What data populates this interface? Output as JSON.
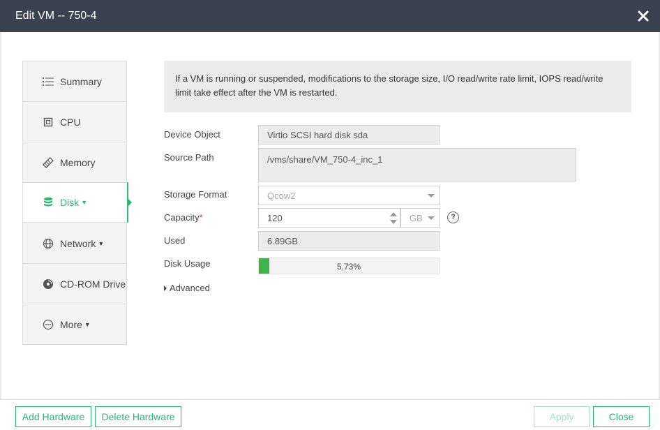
{
  "dialog": {
    "title": "Edit VM -- 750-4"
  },
  "nav": {
    "items": [
      {
        "label": "Summary",
        "icon": "list-icon"
      },
      {
        "label": "CPU",
        "icon": "cpu-icon"
      },
      {
        "label": "Memory",
        "icon": "memory-icon"
      },
      {
        "label": "Disk",
        "icon": "database-icon",
        "active": true,
        "dropdown": true
      },
      {
        "label": "Network",
        "icon": "globe-icon",
        "dropdown": true
      },
      {
        "label": "CD-ROM Drive",
        "icon": "disc-icon"
      },
      {
        "label": "More",
        "icon": "more-icon",
        "dropdown": true
      }
    ]
  },
  "notice": "If a VM is running or suspended, modifications to the storage size, I/O read/write rate limit, IOPS read/write limit take effect after the VM is restarted.",
  "form": {
    "device_object": {
      "label": "Device Object",
      "value": "Virtio SCSI hard disk sda"
    },
    "source_path": {
      "label": "Source Path",
      "value": "/vms/share/VM_750-4_inc_1"
    },
    "storage_format": {
      "label": "Storage Format",
      "value": "Qcow2"
    },
    "capacity": {
      "label": "Capacity",
      "required_mark": "*",
      "value": "120",
      "unit": "GB",
      "help": "?"
    },
    "used": {
      "label": "Used",
      "value": "6.89GB"
    },
    "disk_usage": {
      "label": "Disk Usage",
      "percent_text": "5.73%",
      "percent": 5.73
    },
    "advanced": "Advanced"
  },
  "footer": {
    "add_hardware": "Add Hardware",
    "delete_hardware": "Delete Hardware",
    "apply": "Apply",
    "close": "Close"
  },
  "colors": {
    "titlebar": "#3a4150",
    "accent": "#2bb673",
    "progress_fill": "#3cb44a"
  }
}
